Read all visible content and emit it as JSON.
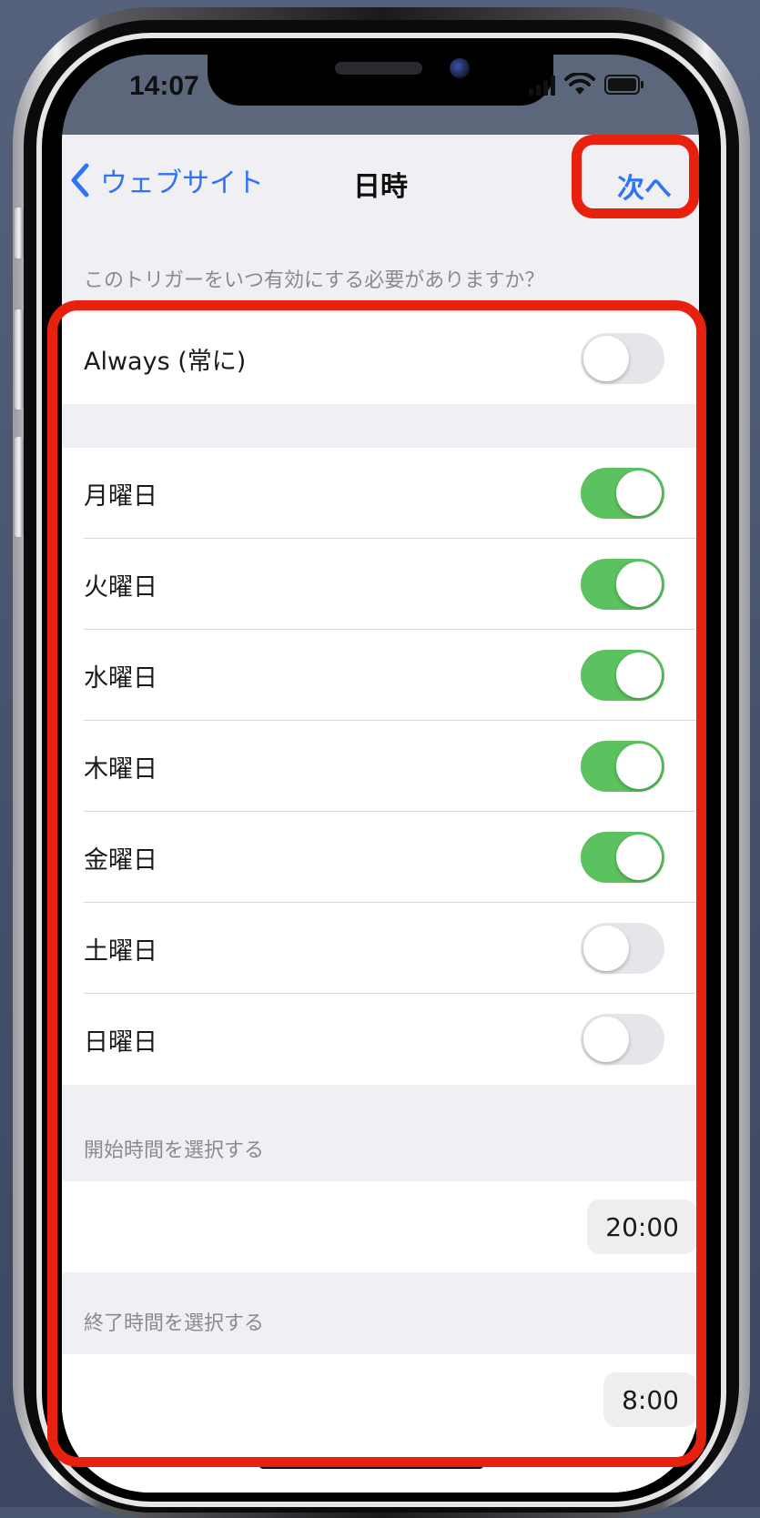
{
  "status_bar": {
    "time": "14:07"
  },
  "nav": {
    "back_label": "ウェブサイト",
    "title": "日時",
    "next_label": "次へ"
  },
  "prompt_header": "このトリガーをいつ有効にする必要がありますか？",
  "always_row": {
    "label": "Always (常に)",
    "on": false
  },
  "days": [
    {
      "label": "月曜日",
      "on": true
    },
    {
      "label": "火曜日",
      "on": true
    },
    {
      "label": "水曜日",
      "on": true
    },
    {
      "label": "木曜日",
      "on": true
    },
    {
      "label": "金曜日",
      "on": true
    },
    {
      "label": "土曜日",
      "on": false
    },
    {
      "label": "日曜日",
      "on": false
    }
  ],
  "start_time": {
    "header": "開始時間を選択する",
    "value": "20:00"
  },
  "end_time": {
    "header": "終了時間を選択する",
    "value": "8:00"
  },
  "colors": {
    "accent": "#2f74f5",
    "toggle_on": "#5bc25f",
    "highlight": "#e8200e"
  },
  "icons": [
    "chevron-left-icon",
    "signal-icon",
    "wifi-icon",
    "battery-icon"
  ]
}
